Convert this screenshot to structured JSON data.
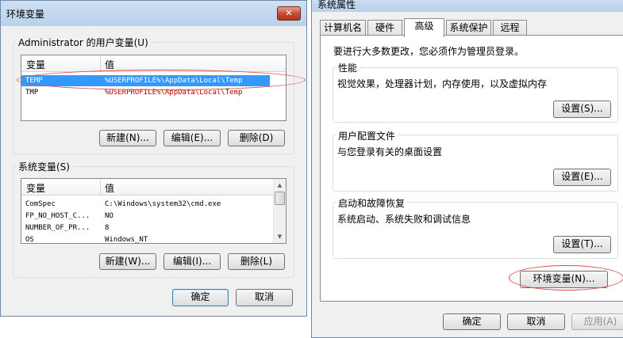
{
  "env_dialog": {
    "title": "环境变量",
    "close_glyph": "✕",
    "user_group_label": "Administrator 的用户变量(U)",
    "user_columns": [
      "变量",
      "值"
    ],
    "user_rows": [
      {
        "name": "TEMP",
        "value": "%USERPROFILE%\\AppData\\Local\\Temp",
        "selected": true
      },
      {
        "name": "TMP",
        "value": "%USERPROFILE%\\AppData\\Local\\Temp",
        "selected": false
      }
    ],
    "user_buttons": {
      "new": "新建(N)...",
      "edit": "编辑(E)...",
      "delete": "删除(D)"
    },
    "system_group_label": "系统变量(S)",
    "system_columns": [
      "变量",
      "值"
    ],
    "system_rows": [
      {
        "name": "ComSpec",
        "value": "C:\\Windows\\system32\\cmd.exe"
      },
      {
        "name": "FP_NO_HOST_C...",
        "value": "NO"
      },
      {
        "name": "NUMBER_OF_PR...",
        "value": "8"
      },
      {
        "name": "OS",
        "value": "Windows_NT"
      }
    ],
    "system_buttons": {
      "new": "新建(W)...",
      "edit": "编辑(I)...",
      "delete": "删除(L)"
    },
    "ok": "确定",
    "cancel": "取消"
  },
  "sys_dialog": {
    "title": "系统属性",
    "tabs": [
      "计算机名",
      "硬件",
      "高级",
      "系统保护",
      "远程"
    ],
    "active_tab": "高级",
    "admin_note": "要进行大多数更改，您必须作为管理员登录。",
    "performance": {
      "label": "性能",
      "desc": "视觉效果，处理器计划，内存使用，以及虚拟内存",
      "button": "设置(S)..."
    },
    "profiles": {
      "label": "用户配置文件",
      "desc": "与您登录有关的桌面设置",
      "button": "设置(E)..."
    },
    "startup": {
      "label": "启动和故障恢复",
      "desc": "系统启动、系统失败和调试信息",
      "button": "设置(T)..."
    },
    "env_button": "环境变量(N)...",
    "ok": "确定",
    "cancel": "取消",
    "apply": "应用(A)"
  },
  "colors": {
    "selection": "#3399ff",
    "annotation": "#e04848",
    "value_text": "#b40000"
  }
}
